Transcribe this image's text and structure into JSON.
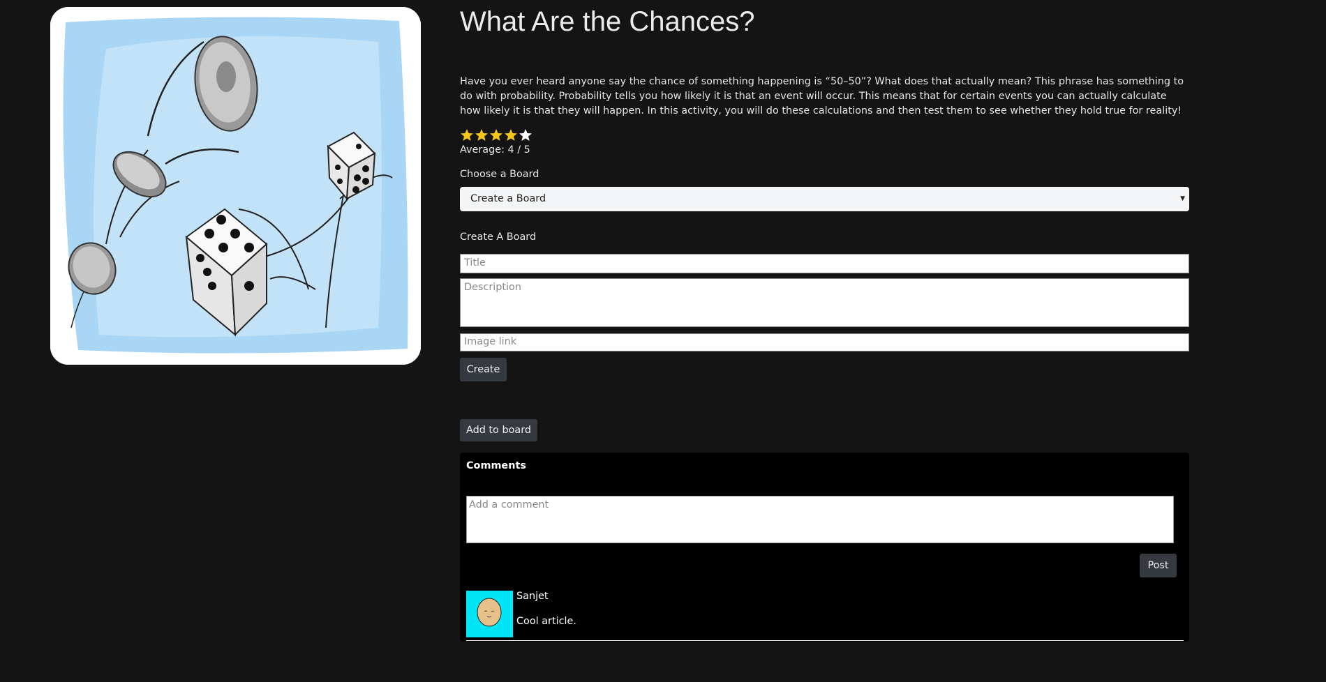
{
  "article": {
    "title": "What Are the Chances?",
    "description": "Have you ever heard anyone say the chance of something happening is “50–50”? What does that actually mean? This phrase has something to do with probability. Probability tells you how likely it is that an event will occur. This means that for certain events you can actually calculate how likely it is that they will happen. In this activity, you will do these calculations and then test them to see whether they hold true for reality!",
    "rating": {
      "filled": 4,
      "total": 5,
      "average_text": "Average: 4 / 5"
    }
  },
  "board": {
    "choose_label": "Choose a Board",
    "selected_option": "Create a Board",
    "create_heading": "Create A Board",
    "title_placeholder": "Title",
    "description_placeholder": "Description",
    "image_placeholder": "Image link",
    "create_button": "Create",
    "add_button": "Add to board"
  },
  "comments": {
    "heading": "Comments",
    "input_placeholder": "Add a comment",
    "post_button": "Post",
    "items": [
      {
        "user": "Sanjet",
        "text": "Cool article."
      }
    ]
  },
  "colors": {
    "background": "#141414",
    "button": "#343a40",
    "star": "#f5c518",
    "avatar_bg": "#00e5f5"
  }
}
